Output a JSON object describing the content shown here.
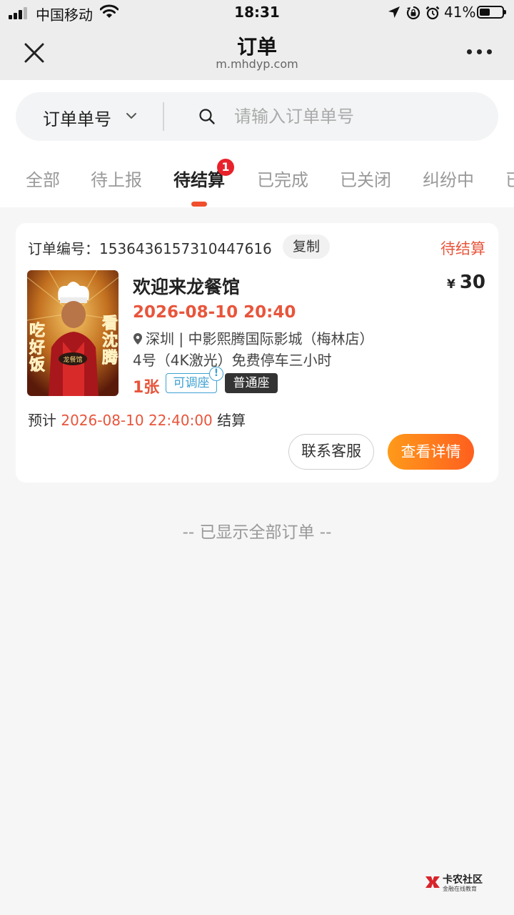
{
  "status_bar": {
    "carrier": "中国移动",
    "time": "18:31",
    "battery": "41%"
  },
  "nav": {
    "title": "订单",
    "url": "m.mhdyp.com"
  },
  "search": {
    "type_label": "订单单号",
    "placeholder": "请输入订单单号",
    "value": ""
  },
  "tabs": [
    {
      "label": "全部"
    },
    {
      "label": "待上报"
    },
    {
      "label": "待结算",
      "badge": "1",
      "active": true
    },
    {
      "label": "已完成"
    },
    {
      "label": "已关闭"
    },
    {
      "label": "纠纷中"
    },
    {
      "label": "已"
    }
  ],
  "order": {
    "number_label": "订单编号：1536436157310447616",
    "copy_label": "复制",
    "status": "待结算",
    "poster_text": {
      "left": "吃好饭",
      "right": "看沈腾"
    },
    "title": "欢迎来龙餐馆",
    "currency": "¥",
    "price": "30",
    "showtime": "2026-08-10 20:40",
    "cinema": "深圳 | 中影熙腾国际影城（梅林店）",
    "hall": "4号（4K激光）免费停车三小时",
    "quantity": "1张",
    "adjust_tag": "可调座",
    "info_mark": "!",
    "seat_tag": "普通座",
    "settle_prefix": "预计",
    "settle_time": "2026-08-10 22:40:00",
    "settle_suffix": "结算",
    "contact_label": "联系客服",
    "detail_label": "查看详情"
  },
  "end_note": "-- 已显示全部订单 --",
  "watermark": {
    "name": "卡农社区",
    "subtitle": "金融在线教育"
  },
  "colors": {
    "accent": "#e8553b",
    "button_gradient": [
      "#ff9a1a",
      "#ff5f1f"
    ],
    "tag_blue": "#3fa2d2",
    "badge_red": "#e8222c"
  }
}
